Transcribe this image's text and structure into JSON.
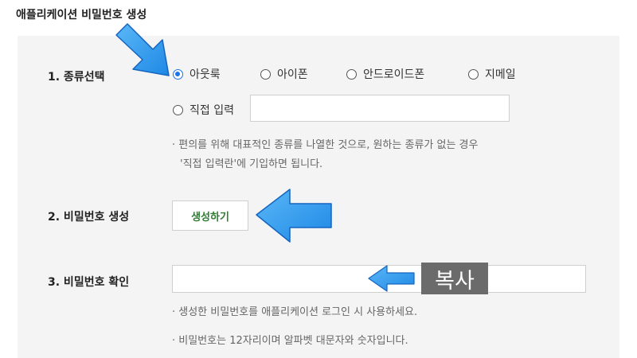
{
  "page_title": "애플리케이션 비밀번호 생성",
  "section1": {
    "label": "1. 종류선택",
    "options": [
      "아웃룩",
      "아이폰",
      "안드로이드폰",
      "지메일"
    ],
    "selected": "아웃룩",
    "direct_label": "직접 입력",
    "direct_value": "",
    "note_line1": "· 편의를 위해 대표적인 종류를 나열한 것으로, 원하는 종류가 없는 경우",
    "note_line2": "'직접 입력란'에 기입하면 됩니다."
  },
  "section2": {
    "label": "2. 비밀번호 생성",
    "button_label": "생성하기"
  },
  "section3": {
    "label": "3. 비밀번호 확인",
    "password_value": "",
    "copy_label": "복사",
    "note_line1": "· 생성한 비밀번호를 애플리케이션 로그인 시 사용하세요.",
    "note_line2": "· 비밀번호는 12자리이며 알파벳 대문자와 숫자입니다."
  },
  "colors": {
    "panel_bg": "#f4f4f4",
    "radio_selected": "#1a73e8",
    "button_text": "#2e7d32",
    "annotation_arrow": "#2e9bf0",
    "copy_bg": "#6b6b6b"
  }
}
